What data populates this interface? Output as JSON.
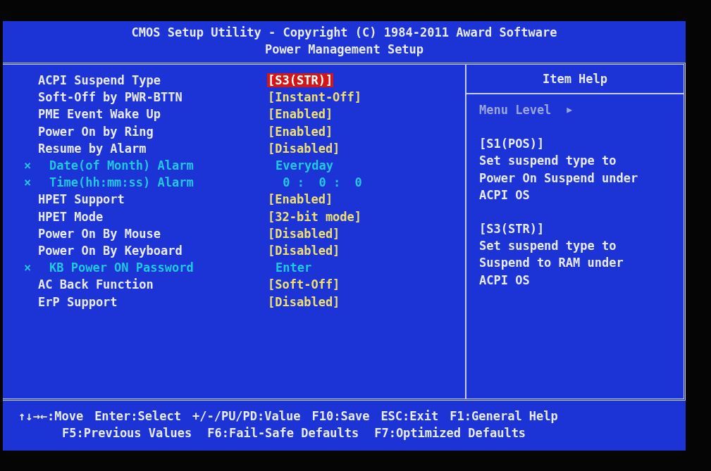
{
  "header": {
    "title": "CMOS Setup Utility - Copyright (C) 1984-2011 Award Software",
    "subtitle": "Power Management Setup"
  },
  "settings": [
    {
      "label": "ACPI Suspend Type",
      "value": "[S3(STR)]",
      "disabled": false,
      "selected": true
    },
    {
      "label": "Soft-Off by PWR-BTTN",
      "value": "[Instant-Off]",
      "disabled": false,
      "selected": false
    },
    {
      "label": "PME Event Wake Up",
      "value": "[Enabled]",
      "disabled": false,
      "selected": false
    },
    {
      "label": "Power On by Ring",
      "value": "[Enabled]",
      "disabled": false,
      "selected": false
    },
    {
      "label": "Resume by Alarm",
      "value": "[Disabled]",
      "disabled": false,
      "selected": false
    },
    {
      "label": "Date(of Month) Alarm",
      "value": "Everyday",
      "disabled": true,
      "marker": "×",
      "selected": false
    },
    {
      "label": "Time(hh:mm:ss) Alarm",
      "value": " 0 :  0 :  0",
      "disabled": true,
      "marker": "×",
      "selected": false
    },
    {
      "label": "HPET Support",
      "value": "[Enabled]",
      "disabled": false,
      "selected": false
    },
    {
      "label": "HPET Mode",
      "value": "[32-bit mode]",
      "disabled": false,
      "selected": false
    },
    {
      "label": "Power On By Mouse",
      "value": "[Disabled]",
      "disabled": false,
      "selected": false
    },
    {
      "label": "Power On By Keyboard",
      "value": "[Disabled]",
      "disabled": false,
      "selected": false
    },
    {
      "label": "KB Power ON Password",
      "value": "Enter",
      "disabled": true,
      "marker": "×",
      "selected": false
    },
    {
      "label": "AC Back Function",
      "value": "[Soft-Off]",
      "disabled": false,
      "selected": false
    },
    {
      "label": "ErP Support",
      "value": "[Disabled]",
      "disabled": false,
      "selected": false
    }
  ],
  "item_help": {
    "title": "Item Help",
    "menu_level": "Menu Level",
    "menu_level_arrow": "▶",
    "paragraphs": [
      {
        "heading": "[S1(POS)]",
        "lines": [
          "Set suspend type to",
          "Power On Suspend under",
          "ACPI OS"
        ]
      },
      {
        "heading": "[S3(STR)]",
        "lines": [
          "Set suspend type to",
          "Suspend to RAM under",
          "ACPI OS"
        ]
      }
    ]
  },
  "footer": [
    [
      "↑↓→←:Move",
      "Enter:Select",
      "+/-/PU/PD:Value",
      "F10:Save",
      "ESC:Exit",
      "F1:General Help"
    ],
    [
      "F5:Previous Values",
      "F6:Fail-Safe Defaults",
      "F7:Optimized Defaults"
    ]
  ]
}
